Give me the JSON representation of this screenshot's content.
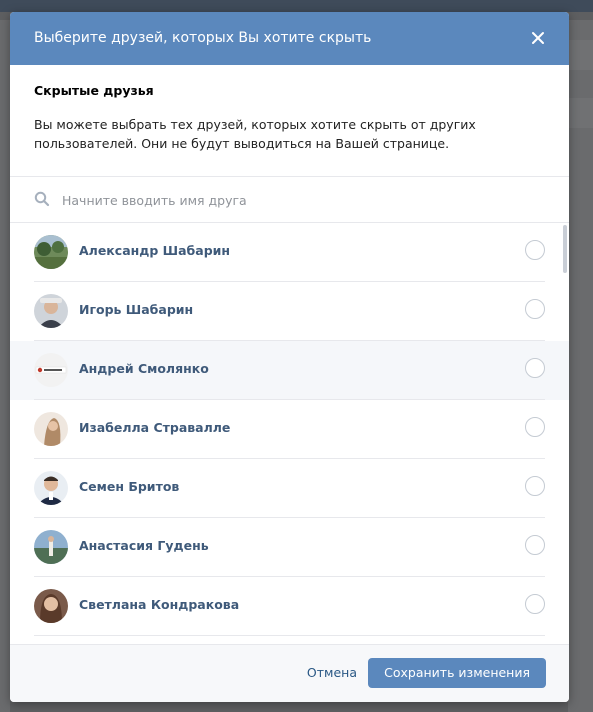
{
  "modal": {
    "title": "Выберите друзей, которых Вы хотите скрыть",
    "info_title": "Скрытые друзья",
    "info_text": "Вы можете выбрать тех друзей, которых хотите скрыть от других пользователей. Они не будут выводиться на Вашей странице."
  },
  "search": {
    "placeholder": "Начните вводить имя друга"
  },
  "friends": [
    {
      "name": "Александр Шабарин",
      "avatar": "green-landscape-photo"
    },
    {
      "name": "Игорь Шабарин",
      "avatar": "man-photo"
    },
    {
      "name": "Андрей Смолянко",
      "avatar": "website-logo"
    },
    {
      "name": "Изабелла Страваллe",
      "avatar": "woman-photo"
    },
    {
      "name": "Семен Бритов",
      "avatar": "man-portrait-photo"
    },
    {
      "name": "Анастасия Гудень",
      "avatar": "outdoor-person-photo"
    },
    {
      "name": "Светлана Кондракова",
      "avatar": "woman-portrait-photo"
    }
  ],
  "footer": {
    "cancel_label": "Отмена",
    "save_label": "Сохранить изменения"
  },
  "colors": {
    "header": "#5b88bd",
    "name": "#3f5a7a",
    "link": "#2a5885"
  }
}
